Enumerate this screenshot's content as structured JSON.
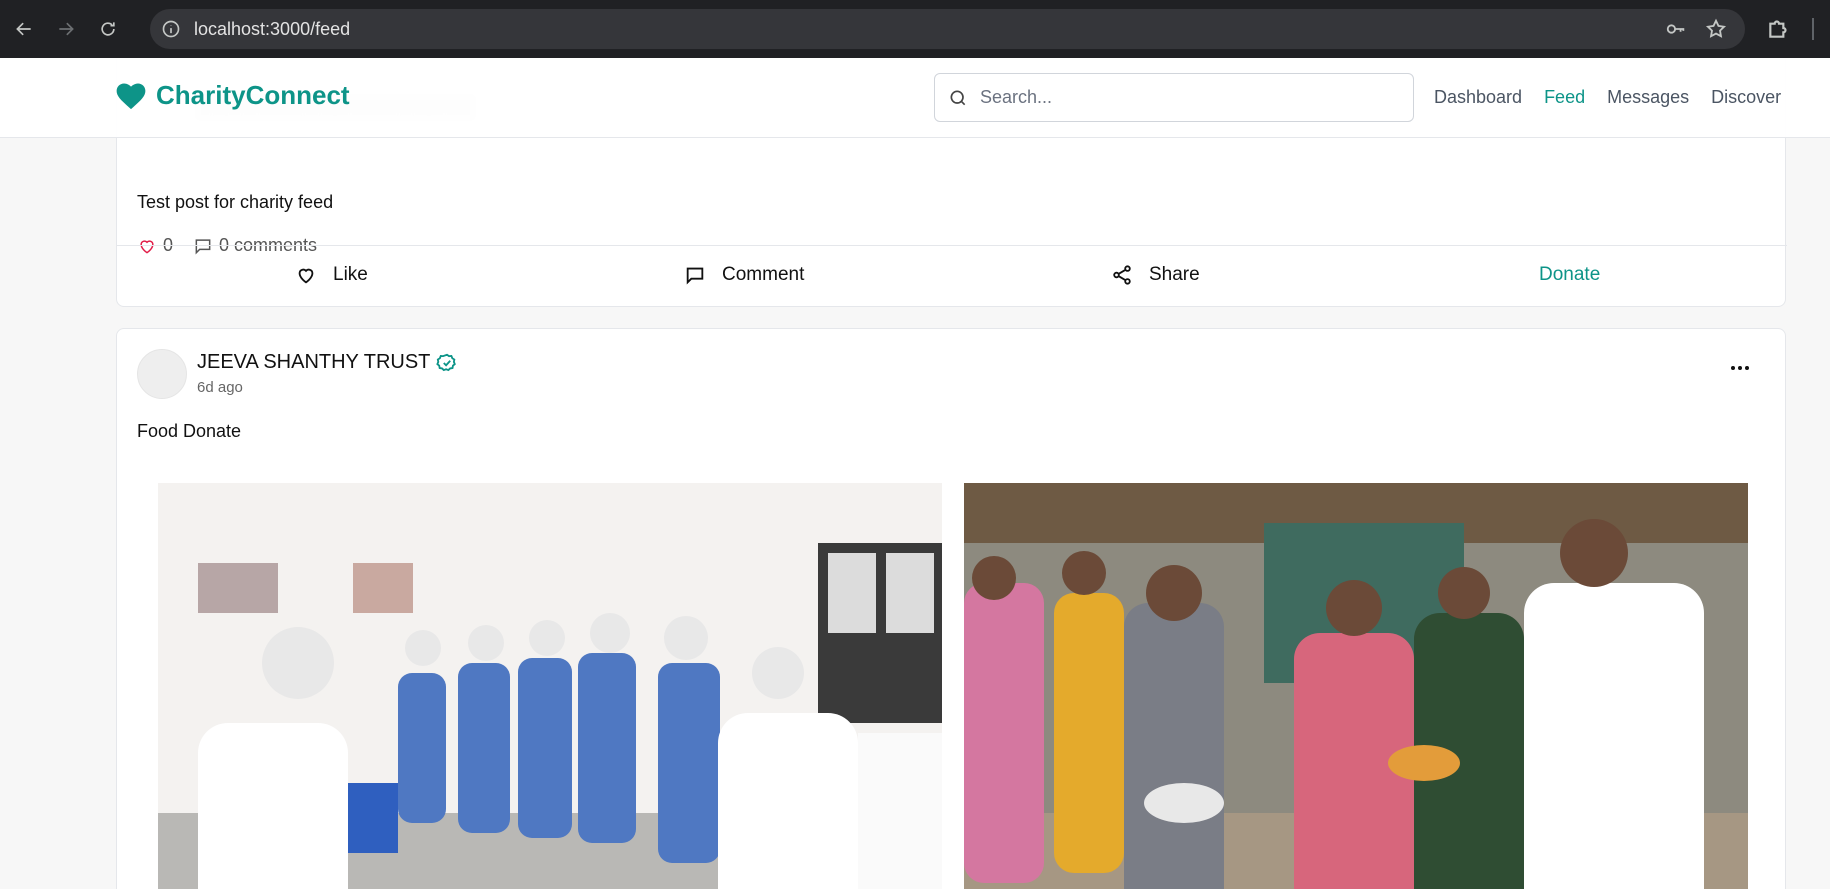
{
  "browser": {
    "url": "localhost:3000/feed"
  },
  "header": {
    "brand": "CharityConnect",
    "search_placeholder": "Search...",
    "nav": [
      "Dashboard",
      "Feed",
      "Messages",
      "Discover"
    ],
    "active_nav": "Feed"
  },
  "post1": {
    "text": "Test post for charity feed",
    "likes": "0",
    "comments": "0 comments",
    "actions": {
      "like": "Like",
      "comment": "Comment",
      "share": "Share",
      "donate": "Donate"
    }
  },
  "post2": {
    "author": "JEEVA SHANTHY TRUST",
    "verified": true,
    "time": "6d ago",
    "text": "Food Donate"
  },
  "colors": {
    "accent": "#0d9488"
  }
}
